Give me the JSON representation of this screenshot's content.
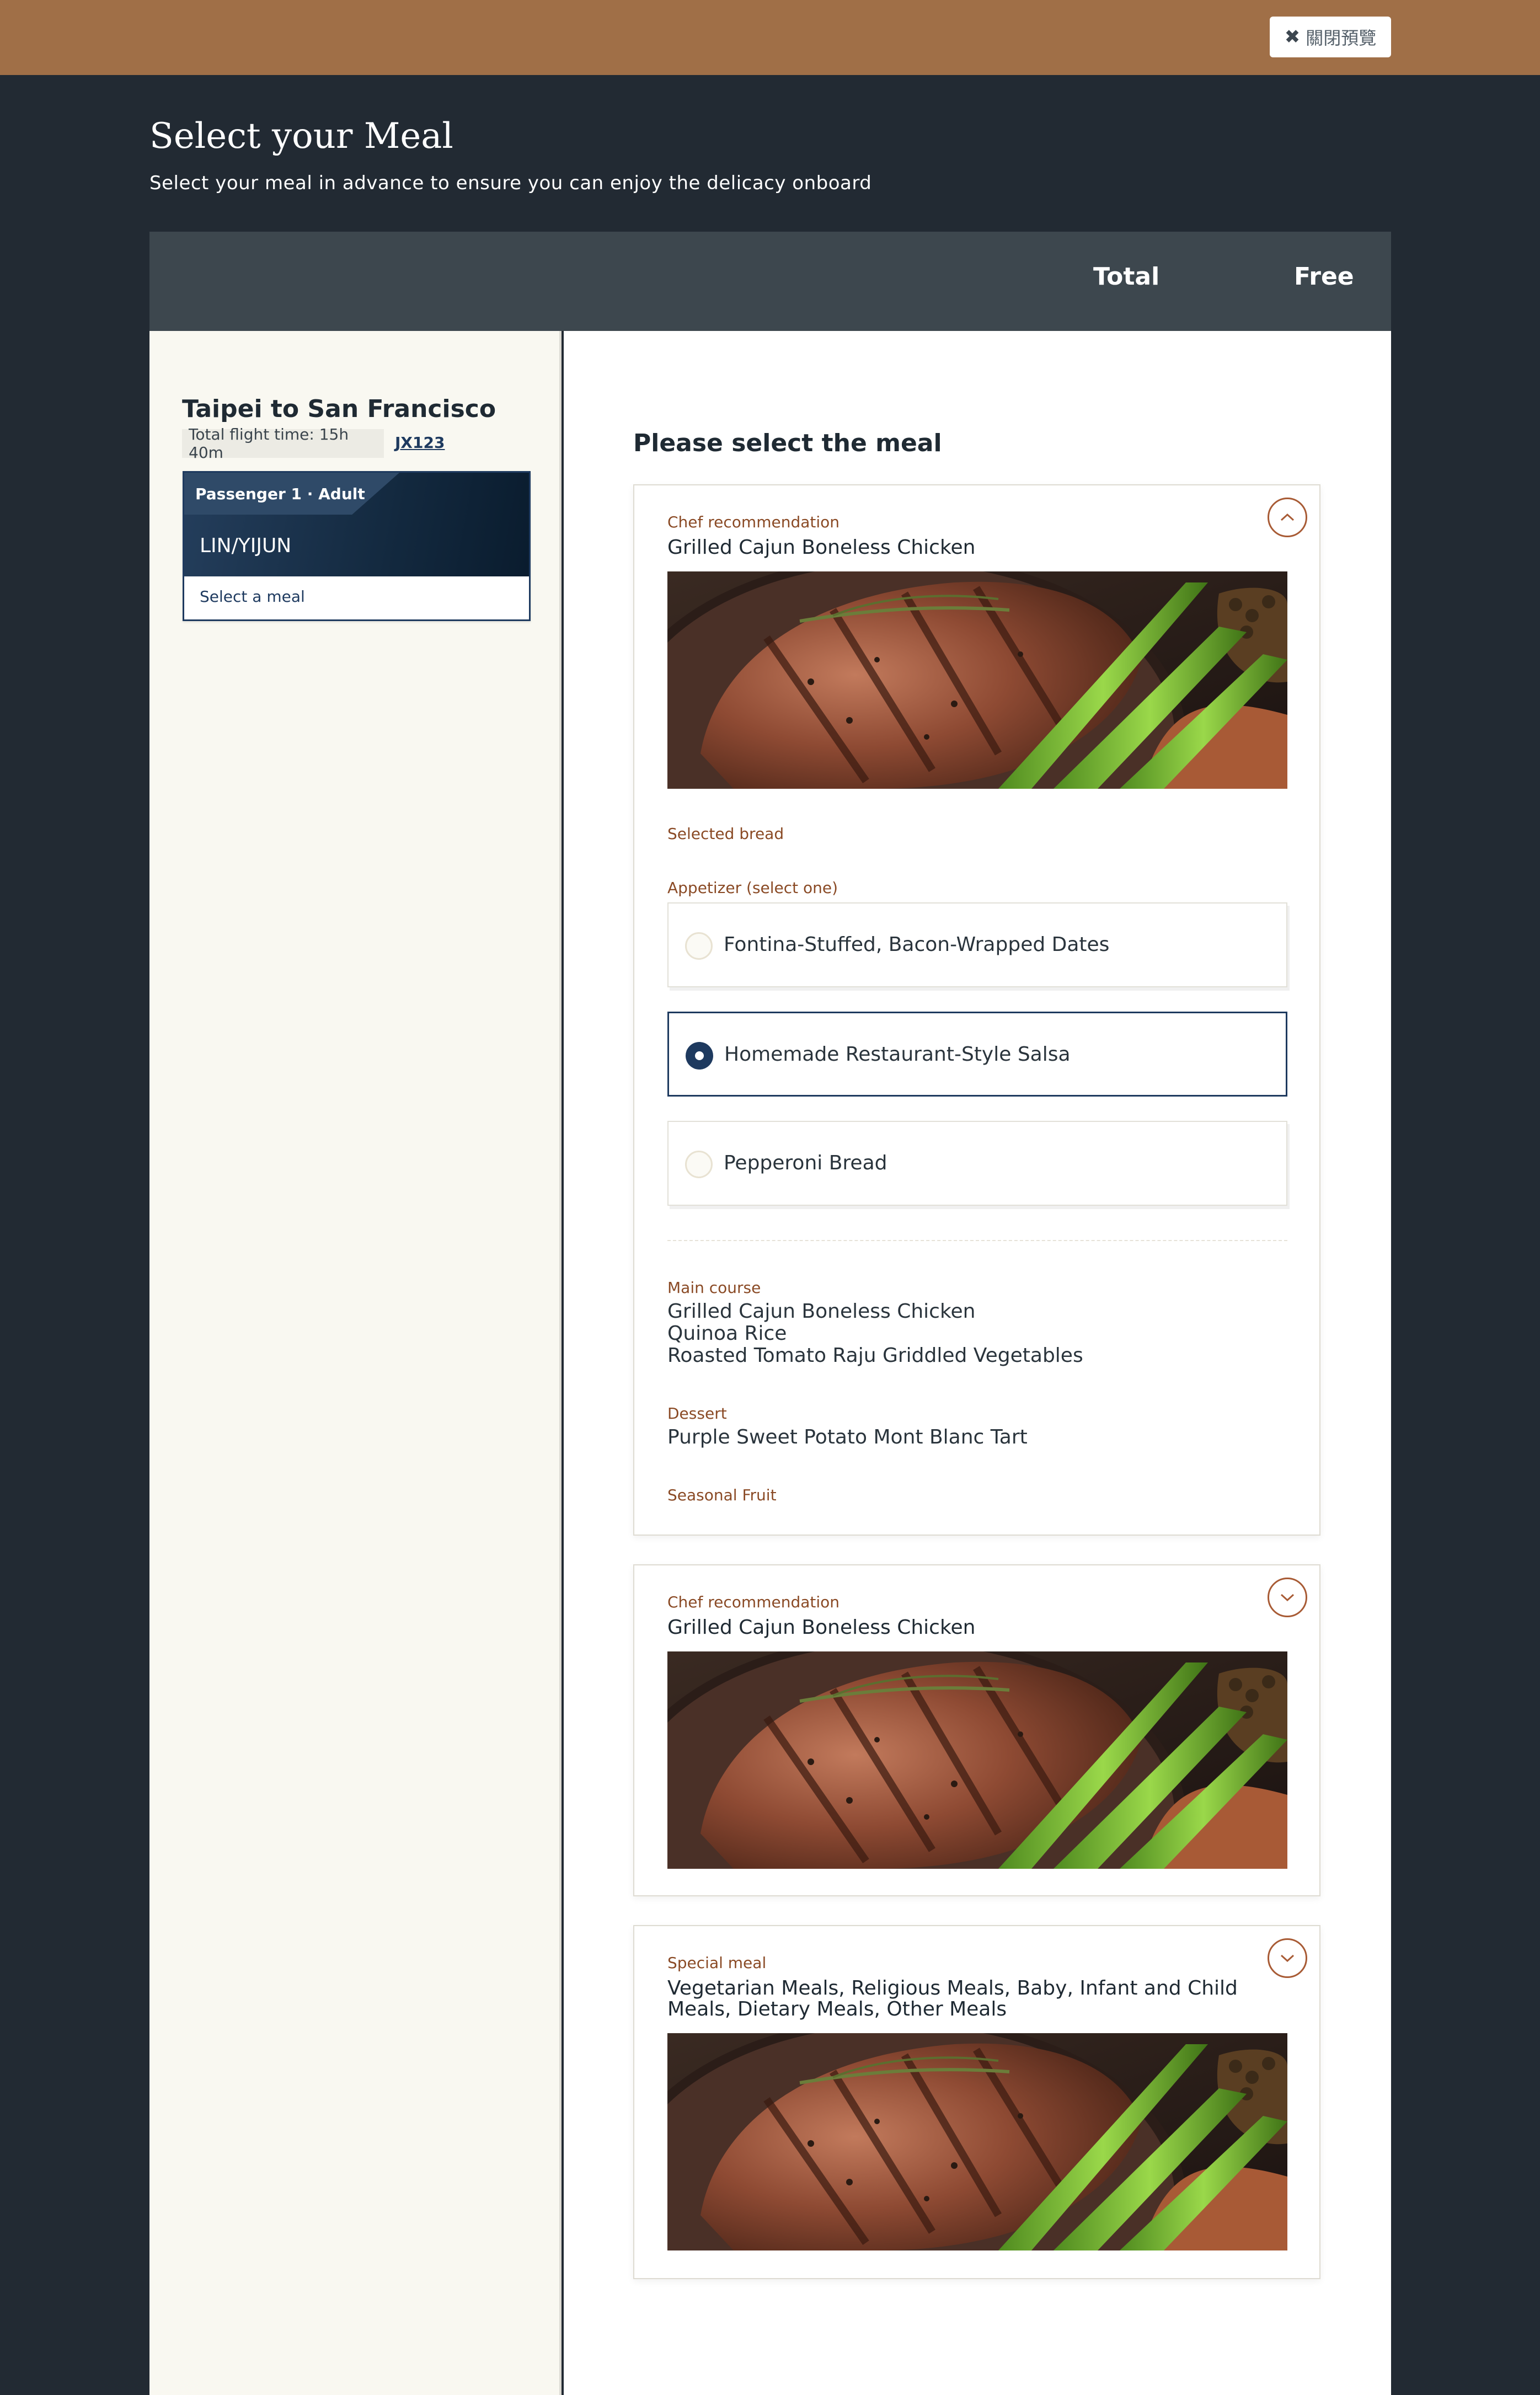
{
  "preview": {
    "close_label": "關閉預覽",
    "close_icon": "close-icon"
  },
  "page": {
    "title": "Select your Meal",
    "subtitle": "Select your meal in advance to ensure you can enjoy the delicacy onboard"
  },
  "summary": {
    "total_label": "Total",
    "total_value": "Free"
  },
  "flight": {
    "route": "Taipei to San Francisco",
    "flight_time": "Total flight time: 15h 40m",
    "flight_number": "JX123"
  },
  "passenger": {
    "label": "Passenger 1 · Adult",
    "name": "LIN/YIJUN",
    "meal_status": "Select a meal"
  },
  "meal_section": {
    "title": "Please select the meal"
  },
  "meals": [
    {
      "category": "Chef recommendation",
      "name": "Grilled Cajun Boneless Chicken",
      "expanded": true,
      "toggle_icon": "chevron-up-icon",
      "bread_label": "Selected bread",
      "appetizer_label": "Appetizer (select one)",
      "appetizers": [
        {
          "label": "Fontina-Stuffed, Bacon-Wrapped Dates",
          "selected": false
        },
        {
          "label": "Homemade Restaurant-Style Salsa",
          "selected": true
        },
        {
          "label": "Pepperoni Bread",
          "selected": false
        }
      ],
      "main_course_label": "Main course",
      "main_course_items": [
        "Grilled Cajun Boneless Chicken",
        "Quinoa Rice",
        "Roasted Tomato Raju Griddled Vegetables"
      ],
      "dessert_label": "Dessert",
      "dessert": "Purple Sweet Potato Mont Blanc Tart",
      "fruit_label": "Seasonal Fruit"
    },
    {
      "category": "Chef recommendation",
      "name": "Grilled Cajun Boneless Chicken",
      "expanded": false,
      "toggle_icon": "chevron-down-icon"
    },
    {
      "category": "Special meal",
      "name": "Vegetarian Meals, Religious Meals, Baby, Infant and Child Meals, Dietary Meals, Other Meals",
      "expanded": false,
      "toggle_icon": "chevron-down-icon"
    }
  ],
  "colors": {
    "header_bar": "#a06f47",
    "page_bg": "#222a33",
    "total_bar": "#3d474e",
    "accent_navy": "#1e3a5f",
    "accent_brown": "#8a4a25"
  }
}
